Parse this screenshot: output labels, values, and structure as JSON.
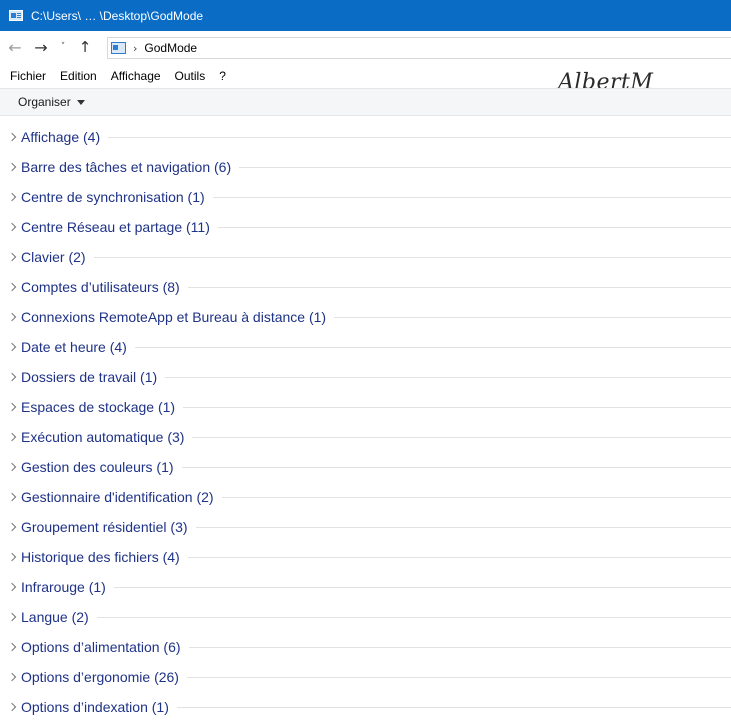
{
  "window": {
    "title": "C:\\Users\\ … \\Desktop\\GodMode"
  },
  "address_bar": {
    "crumb": "GodMode",
    "separator": "›"
  },
  "nav": {
    "back": "←",
    "forward": "→",
    "recent": "˅",
    "up": "↑"
  },
  "menu": {
    "items": [
      "Fichier",
      "Edition",
      "Affichage",
      "Outils",
      "?"
    ]
  },
  "watermark": "AlbertM",
  "command_bar": {
    "organize_label": "Organiser"
  },
  "groups": [
    "Affichage (4)",
    "Barre des tâches et navigation (6)",
    "Centre de synchronisation (1)",
    "Centre Réseau et partage (11)",
    "Clavier (2)",
    "Comptes d’utilisateurs (8)",
    "Connexions RemoteApp et Bureau à distance (1)",
    "Date et heure (4)",
    "Dossiers de travail (1)",
    "Espaces de stockage (1)",
    "Exécution automatique (3)",
    "Gestion des couleurs (1)",
    "Gestionnaire d'identification (2)",
    "Groupement résidentiel (3)",
    "Historique des fichiers (4)",
    "Infrarouge (1)",
    "Langue (2)",
    "Options d’alimentation (6)",
    "Options d’ergonomie (26)",
    "Options d’indexation (1)"
  ],
  "colors": {
    "titlebar": "#0b6cc6",
    "group_label": "#1e3287",
    "command_bar": "#f5f6f7"
  }
}
